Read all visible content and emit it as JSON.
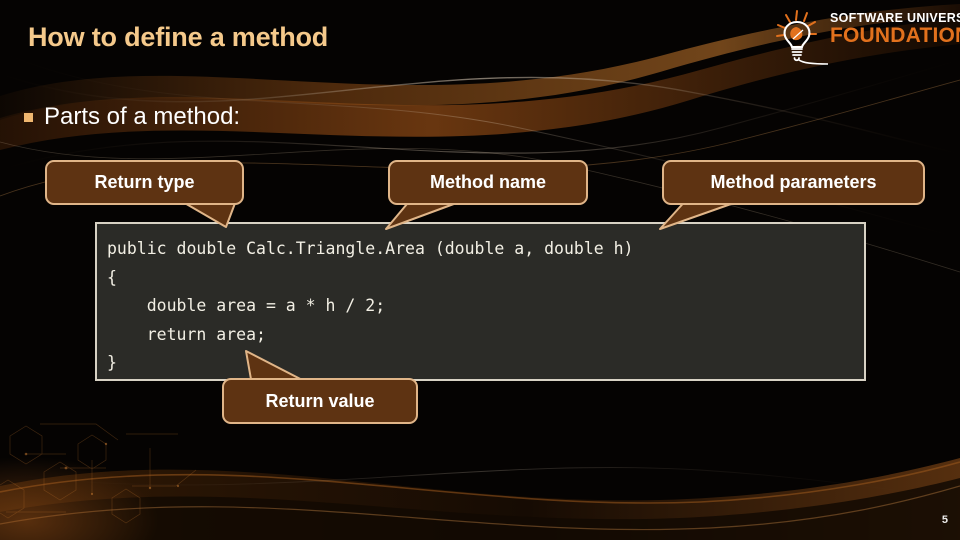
{
  "slide": {
    "title": "How to define a method",
    "page_number": "5",
    "colors": {
      "background": "#050302",
      "title": "#F5C98B",
      "body_text": "#FFFFFF",
      "bullet": "#F0B770",
      "callout_fill": "#5E3312",
      "callout_border": "#E0B588",
      "code_background": "#2B2B27",
      "code_border": "#D8D2C4",
      "code_text": "#F2EFE4",
      "logo_accent": "#E2711D"
    }
  },
  "logo": {
    "icon": "lightbulb-icon",
    "line1": "SOFTWARE UNIVERSITY",
    "line2": "FOUNDATION"
  },
  "body": {
    "bullet_icon": "square-bullet-icon",
    "bullet_text": "Parts of a method:"
  },
  "code": {
    "language": "csharp",
    "lines": [
      "public double Calc.Triangle.Area (double a, double h)",
      "{",
      "    double area = a * h / 2;",
      "    return area;",
      "}"
    ],
    "text": "public double Calc.Triangle.Area (double a, double h)\n{\n    double area = a * h / 2;\n    return area;\n}"
  },
  "callouts": [
    {
      "id": "return-type",
      "label": "Return type",
      "tail": "down-right"
    },
    {
      "id": "method-name",
      "label": "Method name",
      "tail": "down-left"
    },
    {
      "id": "method-parameters",
      "label": "Method parameters",
      "tail": "down-left"
    },
    {
      "id": "return-value",
      "label": "Return value",
      "tail": "up-left"
    }
  ]
}
